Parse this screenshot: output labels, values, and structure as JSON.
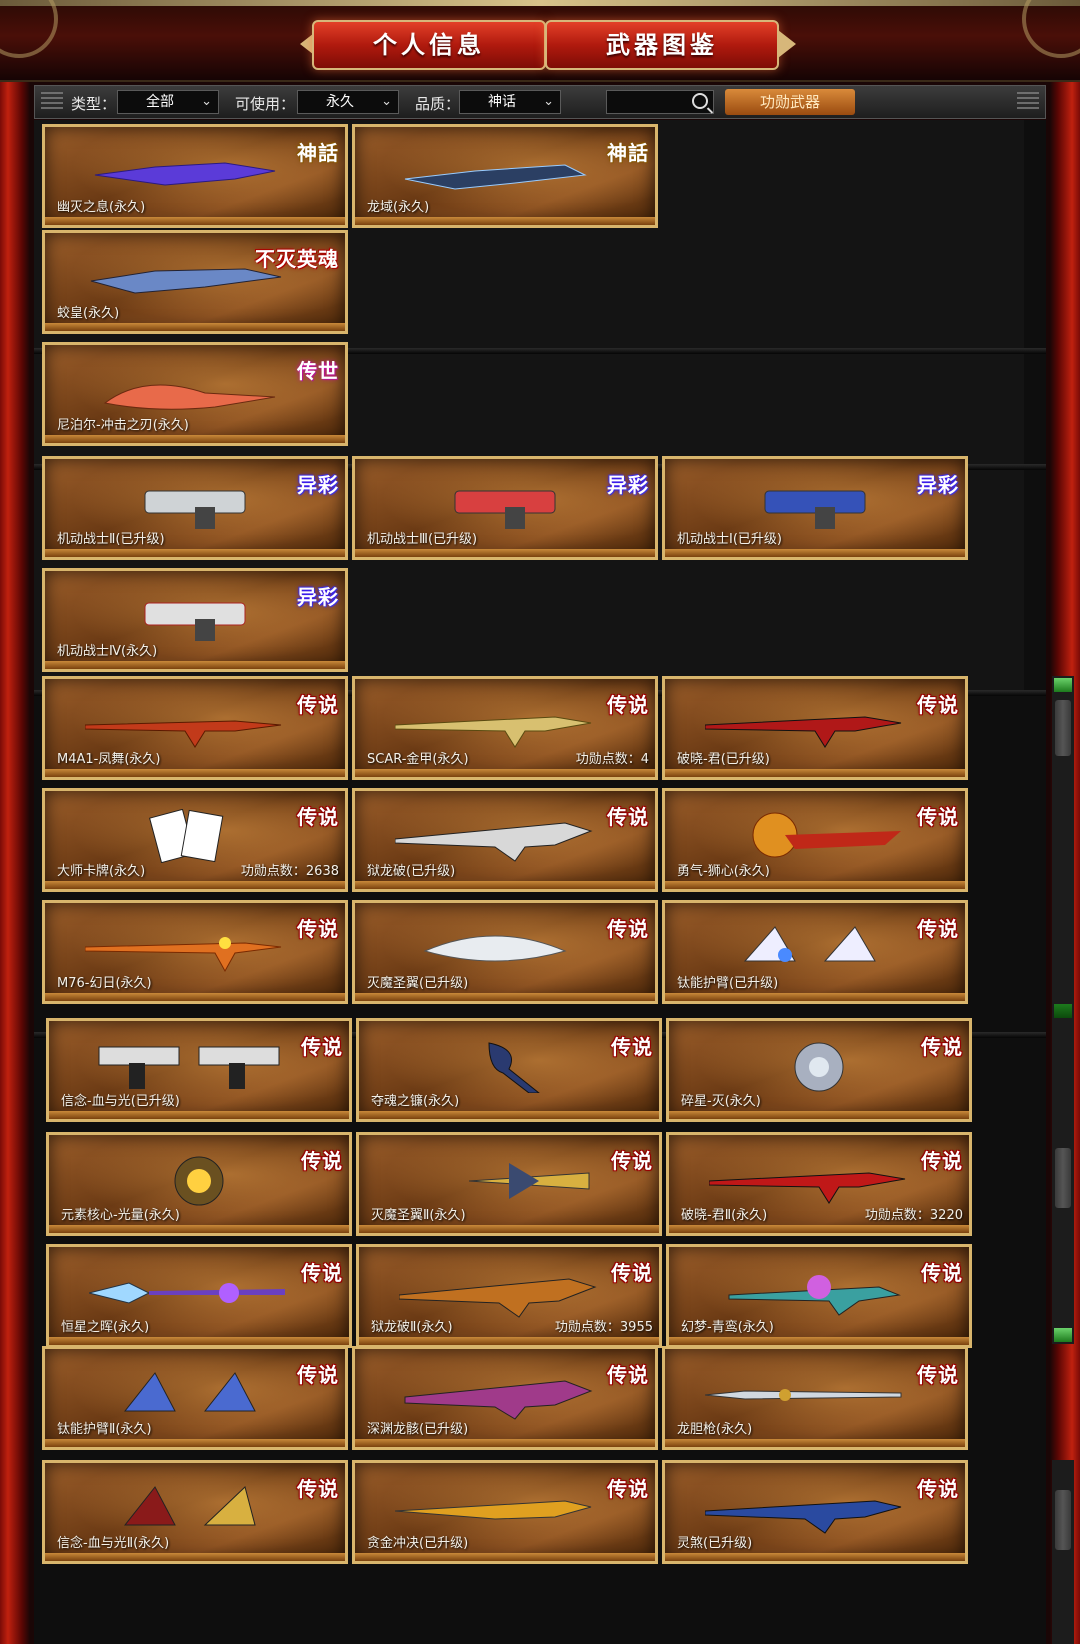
{
  "header": {
    "tab_personal": "个人信息",
    "tab_weapons": "武器图鉴"
  },
  "filters": {
    "type_label": "类型：",
    "type_value": "全部",
    "usable_label": "可使用：",
    "usable_value": "永久",
    "quality_label": "品质：",
    "quality_value": "神话",
    "search_value": "",
    "merit_button": "功勋武器"
  },
  "badges": {
    "myth": "神話",
    "immortal": "不灭英魂",
    "legendary": "传世",
    "exotic": "异彩",
    "legend": "传说"
  },
  "weapons": {
    "w1": {
      "name": "幽灭之息(永久)"
    },
    "w2": {
      "name": "龙域(永久)"
    },
    "w3": {
      "name": "蛟皇(永久)"
    },
    "w4": {
      "name": "尼泊尔-冲击之刃(永久)"
    },
    "w5": {
      "name": "机动战士Ⅱ(已升级)"
    },
    "w6": {
      "name": "机动战士Ⅲ(已升级)"
    },
    "w7": {
      "name": "机动战士Ⅰ(已升级)"
    },
    "w8": {
      "name": "机动战士Ⅳ(永久)"
    },
    "w9": {
      "name": "M4A1-凤舞(永久)"
    },
    "w10": {
      "name": "SCAR-金甲(永久)",
      "merit": "功勋点数：4"
    },
    "w11": {
      "name": "破晓-君(已升级)"
    },
    "w12": {
      "name": "大师卡牌(永久)",
      "merit": "功勋点数：2638"
    },
    "w13": {
      "name": "狱龙破(已升级)"
    },
    "w14": {
      "name": "勇气-狮心(永久)"
    },
    "w15": {
      "name": "M76-幻日(永久)"
    },
    "w16": {
      "name": "灭魔圣翼(已升级)"
    },
    "w17": {
      "name": "钛能护臂(已升级)"
    },
    "w18": {
      "name": "信念-血与光(已升级)"
    },
    "w19": {
      "name": "夺魂之镰(永久)"
    },
    "w20": {
      "name": "碎星-灭(永久)"
    },
    "w21": {
      "name": "元素核心-光量(永久)"
    },
    "w22": {
      "name": "灭魔圣翼Ⅱ(永久)"
    },
    "w23": {
      "name": "破晓-君Ⅱ(永久)",
      "merit": "功勋点数：3220"
    },
    "w24": {
      "name": "恒星之晖(永久)"
    },
    "w25": {
      "name": "狱龙破Ⅱ(永久)",
      "merit": "功勋点数：3955"
    },
    "w26": {
      "name": "幻梦-青鸾(永久)"
    },
    "w27": {
      "name": "钛能护臂Ⅱ(永久)"
    },
    "w28": {
      "name": "深渊龙骸(已升级)"
    },
    "w29": {
      "name": "龙胆枪(永久)"
    },
    "w30": {
      "name": "信念-血与光Ⅱ(永久)"
    },
    "w31": {
      "name": "贪金冲决(已升级)"
    },
    "w32": {
      "name": "灵煞(已升级)"
    }
  },
  "colors": {
    "frame_red": "#c0210f",
    "card_border": "#d8b56c",
    "tab_red": "#b01a0e",
    "merit_orange": "#d98a3a"
  }
}
